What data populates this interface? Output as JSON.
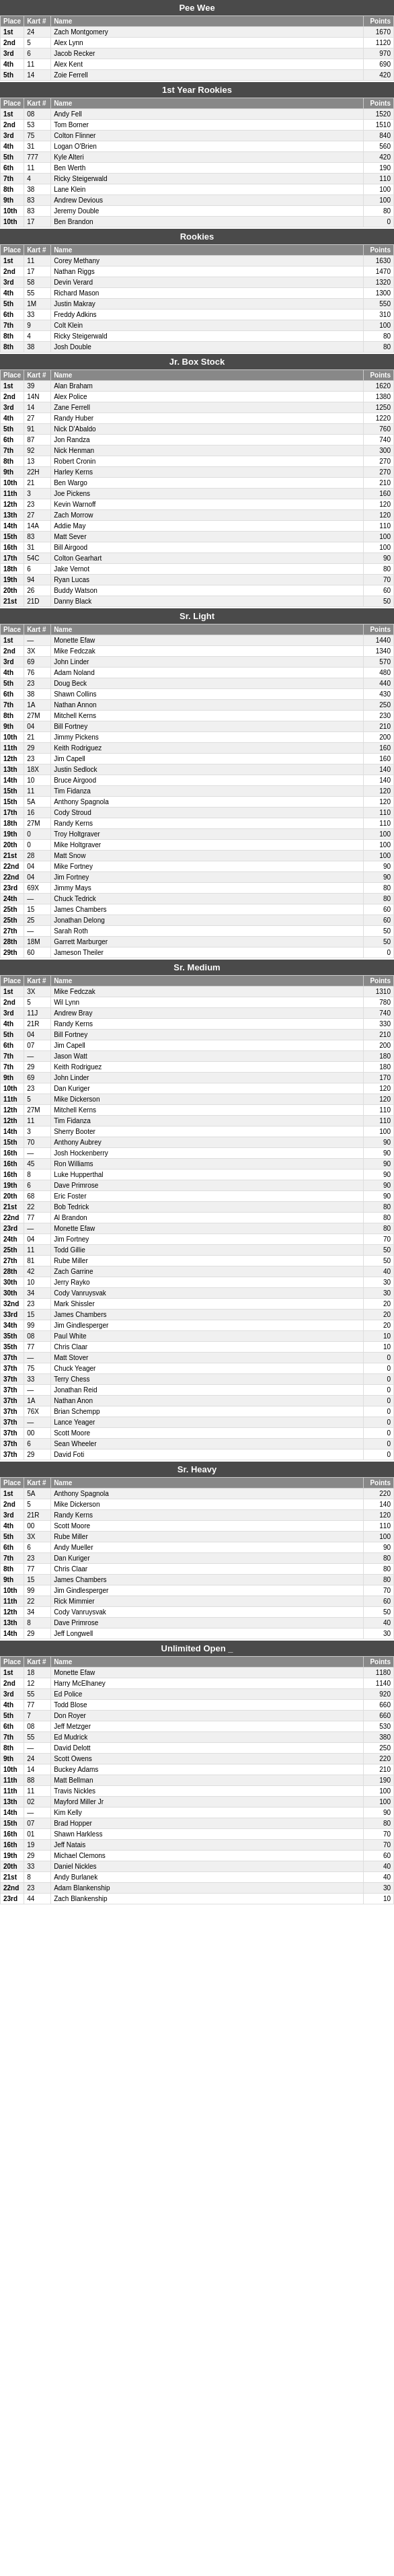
{
  "sections": [
    {
      "id": "pee-wee",
      "title": "Pee Wee",
      "headers": [
        "Place",
        "Kart #",
        "Name",
        "Points"
      ],
      "rows": [
        [
          "1st",
          "24",
          "Zach Montgomery",
          "1670"
        ],
        [
          "2nd",
          "5",
          "Alex Lynn",
          "1120"
        ],
        [
          "3rd",
          "6",
          "Jacob Recker",
          "970"
        ],
        [
          "4th",
          "11",
          "Alex Kent",
          "690"
        ],
        [
          "5th",
          "14",
          "Zoie Ferrell",
          "420"
        ]
      ]
    },
    {
      "id": "first-year-rookies",
      "title": "1st Year Rookies",
      "headers": [
        "Place",
        "Kart #",
        "Name",
        "Points"
      ],
      "rows": [
        [
          "1st",
          "08",
          "Andy Fell",
          "1520"
        ],
        [
          "2nd",
          "53",
          "Tom Borner",
          "1510"
        ],
        [
          "3rd",
          "75",
          "Colton Flinner",
          "840"
        ],
        [
          "4th",
          "31",
          "Logan O'Brien",
          "560"
        ],
        [
          "5th",
          "777",
          "Kyle Alteri",
          "420"
        ],
        [
          "6th",
          "11",
          "Ben Werth",
          "190"
        ],
        [
          "7th",
          "4",
          "Ricky Steigerwald",
          "110"
        ],
        [
          "8th",
          "38",
          "Lane Klein",
          "100"
        ],
        [
          "9th",
          "83",
          "Andrew Devious",
          "100"
        ],
        [
          "10th",
          "83",
          "Jeremy Double",
          "80"
        ],
        [
          "10th",
          "17",
          "Ben Brandon",
          "0"
        ]
      ]
    },
    {
      "id": "rookies",
      "title": "Rookies",
      "headers": [
        "Place",
        "Kart #",
        "Name",
        "Points"
      ],
      "rows": [
        [
          "1st",
          "11",
          "Corey Methany",
          "1630"
        ],
        [
          "2nd",
          "17",
          "Nathan Riggs",
          "1470"
        ],
        [
          "3rd",
          "58",
          "Devin Verard",
          "1320"
        ],
        [
          "4th",
          "55",
          "Richard Mason",
          "1300"
        ],
        [
          "5th",
          "1M",
          "Justin Makray",
          "550"
        ],
        [
          "6th",
          "33",
          "Freddy Adkins",
          "310"
        ],
        [
          "7th",
          "9",
          "Colt Klein",
          "100"
        ],
        [
          "8th",
          "4",
          "Ricky Steigerwald",
          "80"
        ],
        [
          "8th",
          "38",
          "Josh Double",
          "80"
        ]
      ]
    },
    {
      "id": "jr-box-stock",
      "title": "Jr. Box Stock",
      "headers": [
        "Place",
        "Kart #",
        "Name",
        "Points"
      ],
      "rows": [
        [
          "1st",
          "39",
          "Alan Braham",
          "1620"
        ],
        [
          "2nd",
          "14N",
          "Alex Police",
          "1380"
        ],
        [
          "3rd",
          "14",
          "Zane Ferrell",
          "1250"
        ],
        [
          "4th",
          "27",
          "Randy Huber",
          "1220"
        ],
        [
          "5th",
          "91",
          "Nick D'Abaldo",
          "760"
        ],
        [
          "6th",
          "87",
          "Jon Randza",
          "740"
        ],
        [
          "7th",
          "92",
          "Nick Henman",
          "300"
        ],
        [
          "8th",
          "13",
          "Robert Cronin",
          "270"
        ],
        [
          "9th",
          "22H",
          "Harley Kerns",
          "270"
        ],
        [
          "10th",
          "21",
          "Ben Wargo",
          "210"
        ],
        [
          "11th",
          "3",
          "Joe Pickens",
          "160"
        ],
        [
          "12th",
          "23",
          "Kevin Warnoff",
          "120"
        ],
        [
          "13th",
          "27",
          "Zach Morrow",
          "120"
        ],
        [
          "14th",
          "14A",
          "Addie May",
          "110"
        ],
        [
          "15th",
          "83",
          "Matt Sever",
          "100"
        ],
        [
          "16th",
          "31",
          "Bill Airgood",
          "100"
        ],
        [
          "17th",
          "54C",
          "Colton Gearhart",
          "90"
        ],
        [
          "18th",
          "6",
          "Jake Vernot",
          "80"
        ],
        [
          "19th",
          "94",
          "Ryan Lucas",
          "70"
        ],
        [
          "20th",
          "26",
          "Buddy Watson",
          "60"
        ],
        [
          "21st",
          "21D",
          "Danny Black",
          "50"
        ]
      ]
    },
    {
      "id": "sr-light",
      "title": "Sr. Light",
      "headers": [
        "Place",
        "Kart #",
        "Name",
        "Points"
      ],
      "rows": [
        [
          "1st",
          "—",
          "Monette Efaw",
          "1440"
        ],
        [
          "2nd",
          "3X",
          "Mike Fedczak",
          "1340"
        ],
        [
          "3rd",
          "69",
          "John Linder",
          "570"
        ],
        [
          "4th",
          "76",
          "Adam Noland",
          "480"
        ],
        [
          "5th",
          "23",
          "Doug Beck",
          "440"
        ],
        [
          "6th",
          "38",
          "Shawn Collins",
          "430"
        ],
        [
          "7th",
          "1A",
          "Nathan Annon",
          "250"
        ],
        [
          "8th",
          "27M",
          "Mitchell Kerns",
          "230"
        ],
        [
          "9th",
          "04",
          "Bill Fortney",
          "210"
        ],
        [
          "10th",
          "21",
          "Jimmy Pickens",
          "200"
        ],
        [
          "11th",
          "29",
          "Keith Rodriguez",
          "160"
        ],
        [
          "12th",
          "23",
          "Jim Capell",
          "160"
        ],
        [
          "13th",
          "18X",
          "Justin Sedlock",
          "140"
        ],
        [
          "14th",
          "10",
          "Bruce Airgood",
          "140"
        ],
        [
          "15th",
          "11",
          "Tim Fidanza",
          "120"
        ],
        [
          "15th",
          "5A",
          "Anthony Spagnola",
          "120"
        ],
        [
          "17th",
          "16",
          "Cody Stroud",
          "110"
        ],
        [
          "18th",
          "27M",
          "Randy Kerns",
          "110"
        ],
        [
          "19th",
          "0",
          "Troy Holtgraver",
          "100"
        ],
        [
          "20th",
          "0",
          "Mike Holtgraver",
          "100"
        ],
        [
          "21st",
          "28",
          "Matt Snow",
          "100"
        ],
        [
          "22nd",
          "04",
          "Mike Fortney",
          "90"
        ],
        [
          "22nd",
          "04",
          "Jim Fortney",
          "90"
        ],
        [
          "23rd",
          "69X",
          "Jimmy Mays",
          "80"
        ],
        [
          "24th",
          "—",
          "Chuck Tedrick",
          "80"
        ],
        [
          "25th",
          "15",
          "James Chambers",
          "60"
        ],
        [
          "25th",
          "25",
          "Jonathan Delong",
          "60"
        ],
        [
          "27th",
          "—",
          "Sarah Roth",
          "50"
        ],
        [
          "28th",
          "18M",
          "Garrett Marburger",
          "50"
        ],
        [
          "29th",
          "60",
          "Jameson Theiler",
          "0"
        ]
      ]
    },
    {
      "id": "sr-medium",
      "title": "Sr. Medium",
      "headers": [
        "Place",
        "Kart #",
        "Name",
        "Points"
      ],
      "rows": [
        [
          "1st",
          "3X",
          "Mike Fedczak",
          "1310"
        ],
        [
          "2nd",
          "5",
          "Wil Lynn",
          "780"
        ],
        [
          "3rd",
          "11J",
          "Andrew Bray",
          "740"
        ],
        [
          "4th",
          "21R",
          "Randy Kerns",
          "330"
        ],
        [
          "5th",
          "04",
          "Bill Fortney",
          "210"
        ],
        [
          "6th",
          "07",
          "Jim Capell",
          "200"
        ],
        [
          "7th",
          "—",
          "Jason Watt",
          "180"
        ],
        [
          "7th",
          "29",
          "Keith Rodriguez",
          "180"
        ],
        [
          "9th",
          "69",
          "John Linder",
          "170"
        ],
        [
          "10th",
          "23",
          "Dan Kuriger",
          "120"
        ],
        [
          "11th",
          "5",
          "Mike Dickerson",
          "120"
        ],
        [
          "12th",
          "27M",
          "Mitchell Kerns",
          "110"
        ],
        [
          "12th",
          "11",
          "Tim Fidanza",
          "110"
        ],
        [
          "14th",
          "3",
          "Sherry Booter",
          "100"
        ],
        [
          "15th",
          "70",
          "Anthony Aubrey",
          "90"
        ],
        [
          "16th",
          "—",
          "Josh Hockenberry",
          "90"
        ],
        [
          "16th",
          "45",
          "Ron Williams",
          "90"
        ],
        [
          "16th",
          "8",
          "Luke Hupperthal",
          "90"
        ],
        [
          "19th",
          "6",
          "Dave Primrose",
          "90"
        ],
        [
          "20th",
          "68",
          "Eric Foster",
          "90"
        ],
        [
          "21st",
          "22",
          "Bob Tedrick",
          "80"
        ],
        [
          "22nd",
          "77",
          "Al Brandon",
          "80"
        ],
        [
          "23rd",
          "—",
          "Monette Efaw",
          "80"
        ],
        [
          "24th",
          "04",
          "Jim Fortney",
          "70"
        ],
        [
          "25th",
          "11",
          "Todd Gillie",
          "50"
        ],
        [
          "27th",
          "81",
          "Rube Miller",
          "50"
        ],
        [
          "28th",
          "42",
          "Zach Garrine",
          "40"
        ],
        [
          "30th",
          "10",
          "Jerry Rayko",
          "30"
        ],
        [
          "30th",
          "34",
          "Cody Vanruysvak",
          "30"
        ],
        [
          "32nd",
          "23",
          "Mark Shissler",
          "20"
        ],
        [
          "33rd",
          "15",
          "James Chambers",
          "20"
        ],
        [
          "34th",
          "99",
          "Jim Gindlesperger",
          "20"
        ],
        [
          "35th",
          "08",
          "Paul White",
          "10"
        ],
        [
          "35th",
          "77",
          "Chris Claar",
          "10"
        ],
        [
          "37th",
          "—",
          "Matt Stover",
          "0"
        ],
        [
          "37th",
          "75",
          "Chuck Yeager",
          "0"
        ],
        [
          "37th",
          "33",
          "Terry Chess",
          "0"
        ],
        [
          "37th",
          "—",
          "Jonathan Reid",
          "0"
        ],
        [
          "37th",
          "1A",
          "Nathan Anon",
          "0"
        ],
        [
          "37th",
          "76X",
          "Brian Schempp",
          "0"
        ],
        [
          "37th",
          "—",
          "Lance Yeager",
          "0"
        ],
        [
          "37th",
          "00",
          "Scott Moore",
          "0"
        ],
        [
          "37th",
          "6",
          "Sean Wheeler",
          "0"
        ],
        [
          "37th",
          "29",
          "David Foti",
          "0"
        ]
      ]
    },
    {
      "id": "sr-heavy",
      "title": "Sr. Heavy",
      "headers": [
        "Place",
        "Kart #",
        "Name",
        "Points"
      ],
      "rows": [
        [
          "1st",
          "5A",
          "Anthony Spagnola",
          "220"
        ],
        [
          "2nd",
          "5",
          "Mike Dickerson",
          "140"
        ],
        [
          "3rd",
          "21R",
          "Randy Kerns",
          "120"
        ],
        [
          "4th",
          "00",
          "Scott Moore",
          "110"
        ],
        [
          "5th",
          "3X",
          "Rube Miller",
          "100"
        ],
        [
          "6th",
          "6",
          "Andy Mueller",
          "90"
        ],
        [
          "7th",
          "23",
          "Dan Kuriger",
          "80"
        ],
        [
          "8th",
          "77",
          "Chris Claar",
          "80"
        ],
        [
          "9th",
          "15",
          "James Chambers",
          "80"
        ],
        [
          "10th",
          "99",
          "Jim Gindlesperger",
          "70"
        ],
        [
          "11th",
          "22",
          "Rick Mimmier",
          "60"
        ],
        [
          "12th",
          "34",
          "Cody Vanruysvak",
          "50"
        ],
        [
          "13th",
          "8",
          "Dave Primrose",
          "40"
        ],
        [
          "14th",
          "29",
          "Jeff Longwell",
          "30"
        ]
      ]
    },
    {
      "id": "unlimited-open",
      "title": "Unlimited Open _",
      "headers": [
        "Place",
        "Kart #",
        "Name",
        "Points"
      ],
      "rows": [
        [
          "1st",
          "18",
          "Monette Efaw",
          "1180"
        ],
        [
          "2nd",
          "12",
          "Harry McElhaney",
          "1140"
        ],
        [
          "3rd",
          "55",
          "Ed Police",
          "920"
        ],
        [
          "4th",
          "77",
          "Todd Blose",
          "660"
        ],
        [
          "5th",
          "7",
          "Don Royer",
          "660"
        ],
        [
          "6th",
          "08",
          "Jeff Metzger",
          "530"
        ],
        [
          "7th",
          "55",
          "Ed Mudrick",
          "380"
        ],
        [
          "8th",
          "—",
          "David Delott",
          "250"
        ],
        [
          "9th",
          "24",
          "Scott Owens",
          "220"
        ],
        [
          "10th",
          "14",
          "Buckey Adams",
          "210"
        ],
        [
          "11th",
          "88",
          "Matt Bellman",
          "190"
        ],
        [
          "11th",
          "11",
          "Travis Nickles",
          "100"
        ],
        [
          "13th",
          "02",
          "Mayford Miller Jr",
          "100"
        ],
        [
          "14th",
          "—",
          "Kim Kelly",
          "90"
        ],
        [
          "15th",
          "07",
          "Brad Hopper",
          "80"
        ],
        [
          "16th",
          "01",
          "Shawn Harkless",
          "70"
        ],
        [
          "16th",
          "19",
          "Jeff Natais",
          "70"
        ],
        [
          "19th",
          "29",
          "Michael Clemons",
          "60"
        ],
        [
          "20th",
          "33",
          "Daniel Nickles",
          "40"
        ],
        [
          "21st",
          "8",
          "Andy Burlanek",
          "40"
        ],
        [
          "22nd",
          "23",
          "Adam Blankenship",
          "30"
        ],
        [
          "23rd",
          "44",
          "Zach Blankenship",
          "10"
        ]
      ]
    }
  ]
}
